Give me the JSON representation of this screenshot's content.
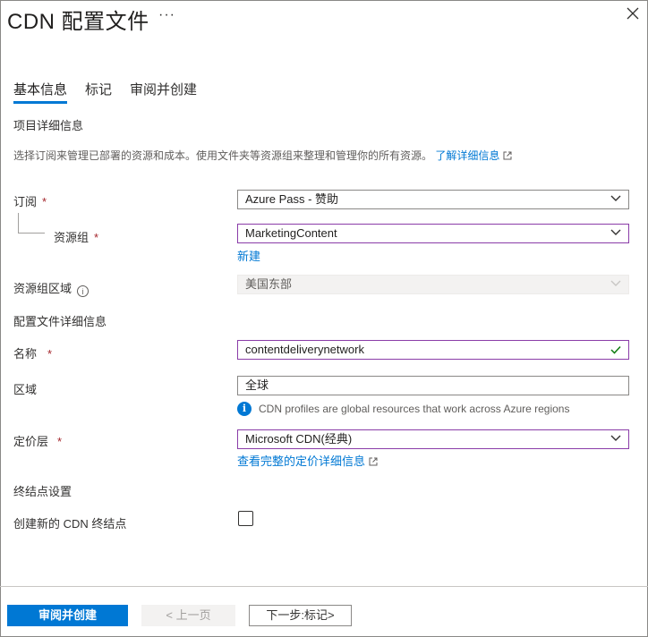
{
  "header": {
    "title": "CDN 配置文件",
    "more": "···"
  },
  "tabs": [
    {
      "label": "基本信息",
      "active": true
    },
    {
      "label": "标记",
      "active": false
    },
    {
      "label": "审阅并创建",
      "active": false
    }
  ],
  "project_details": {
    "heading": "项目详细信息",
    "description": "选择订阅来管理已部署的资源和成本。使用文件夹等资源组来整理和管理你的所有资源。",
    "learn_more": "了解详细信息"
  },
  "subscription": {
    "label": "订阅",
    "required": "*",
    "value": "Azure Pass - 赞助"
  },
  "resource_group": {
    "label": "资源组",
    "required": "*",
    "value": "MarketingContent",
    "create_new": "新建"
  },
  "resource_group_region": {
    "label": "资源组区域",
    "info": "i",
    "value": "美国东部"
  },
  "profile_details": {
    "heading": "配置文件详细信息"
  },
  "name": {
    "label": "名称",
    "required": "*",
    "value": "contentdeliverynetwork"
  },
  "region": {
    "label": "区域",
    "value": "全球",
    "info_text": "CDN profiles are global resources that work across Azure regions"
  },
  "pricing_tier": {
    "label": "定价层",
    "required": "*",
    "value": "Microsoft CDN(经典)",
    "link": "查看完整的定价详细信息"
  },
  "endpoint_settings": {
    "heading": "终结点设置",
    "create_endpoint_label": "创建新的 CDN 终结点",
    "checked": false
  },
  "footer": {
    "review_create": "审阅并创建",
    "previous": "< 上一页",
    "next": "下一步:标记>"
  },
  "colors": {
    "accent": "#0078d4",
    "focus_border": "#8a3ca8",
    "required": "#a4262c",
    "valid": "#107c10"
  }
}
